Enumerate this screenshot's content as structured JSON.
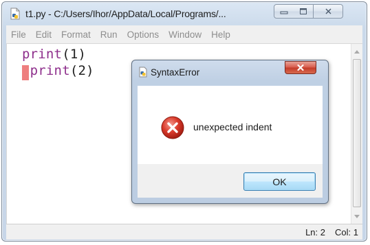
{
  "window": {
    "title": "t1.py - C:/Users/Ihor/AppData/Local/Programs/...",
    "icon": "python-file-icon",
    "controls": [
      "minimize",
      "maximize",
      "close"
    ]
  },
  "menu": {
    "items": [
      "File",
      "Edit",
      "Format",
      "Run",
      "Options",
      "Window",
      "Help"
    ]
  },
  "editor": {
    "lines": [
      {
        "keyword": "print",
        "args": "(1)"
      },
      {
        "keyword": "print",
        "args": "(2)"
      }
    ],
    "error_highlight_color": "#ee7f7f",
    "keyword_color": "#8e2f8c"
  },
  "status": {
    "ln": "Ln: 2",
    "col": "Col: 1"
  },
  "dialog": {
    "title": "SyntaxError",
    "icon": "error-icon",
    "message": "unexpected indent",
    "ok_label": "OK"
  }
}
